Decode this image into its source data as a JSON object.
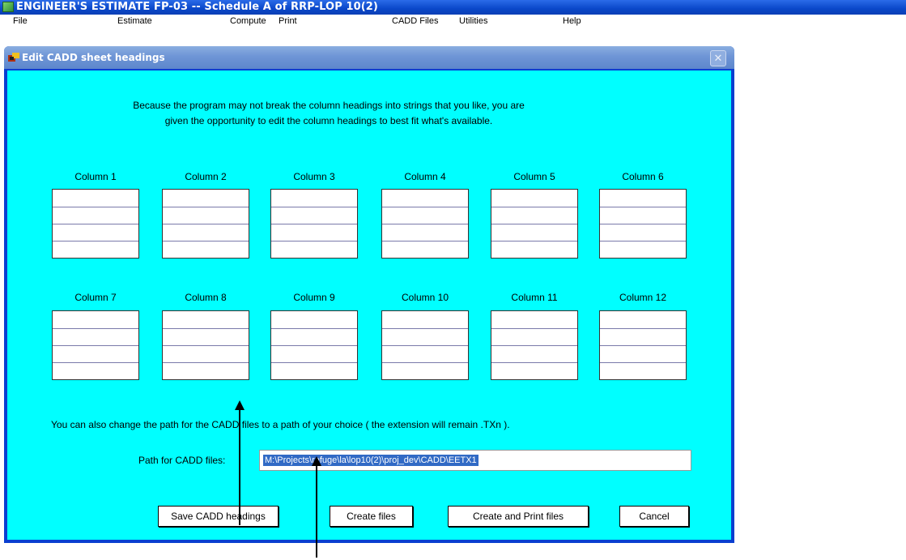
{
  "window": {
    "title": "ENGINEER'S ESTIMATE FP-03 -- Schedule A of RRP-LOP 10(2)"
  },
  "menu": [
    "File",
    "Estimate",
    "Compute",
    "Print",
    "CADD Files",
    "Utilities",
    "Help"
  ],
  "dialog": {
    "title": "Edit CADD sheet headings",
    "close_label": "✕",
    "intro_line1": "Because the program may not break the column headings into strings that you like, you are",
    "intro_line2": "given the opportunity to edit the column headings to best fit what's available.",
    "columns": [
      "Column 1",
      "Column 2",
      "Column 3",
      "Column 4",
      "Column 5",
      "Column 6",
      "Column 7",
      "Column 8",
      "Column 9",
      "Column 10",
      "Column 11",
      "Column 12"
    ],
    "path_note": "You can also change the path for the CADD files to a path of your choice ( the extension will remain .TXn ).",
    "path_label": "Path for CADD files:",
    "path_value": "M:\\Projects\\refuge\\la\\lop10(2)\\proj_dev\\CADD\\EETX1",
    "buttons": {
      "save": "Save CADD headings",
      "create": "Create files",
      "create_print": "Create and Print files",
      "cancel": "Cancel"
    }
  }
}
